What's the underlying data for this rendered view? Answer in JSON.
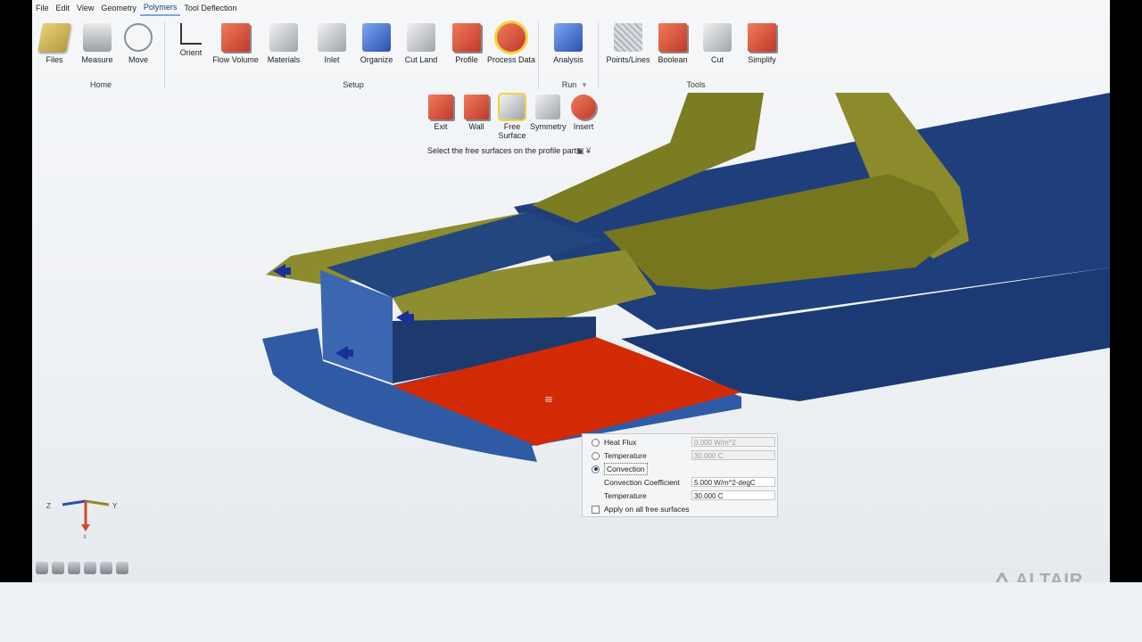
{
  "menubar": {
    "items": [
      "File",
      "Edit",
      "View",
      "Geometry",
      "Polymers",
      "Tool Deflection"
    ],
    "active": "Polymers"
  },
  "ribbon": {
    "home": {
      "label": "Home",
      "tools": [
        "Files",
        "Measure",
        "Move"
      ]
    },
    "setup": {
      "label": "Setup",
      "tools": [
        "Orient",
        "Flow Volume",
        "Materials",
        "Inlet",
        "Organize",
        "Cut Land",
        "Profile",
        "Process Data"
      ]
    },
    "run": {
      "label": "Run",
      "tools": [
        "Analysis"
      ]
    },
    "tools": {
      "label": "Tools",
      "tools": [
        "Points/Lines",
        "Boolean",
        "Cut",
        "Simplify"
      ]
    }
  },
  "profile_subtools": {
    "tools": [
      "Exit",
      "Wall",
      "Free Surface",
      "Symmetry",
      "Insert"
    ],
    "hint": "Select the free surfaces on the profile parts"
  },
  "bc_panel": {
    "heat_flux": {
      "label": "Heat Flux",
      "value": "0.000 W/m^2"
    },
    "temperature": {
      "label": "Temperature",
      "value": "30.000 C"
    },
    "convection": {
      "label": "Convection",
      "selected": true
    },
    "convection_coefficient": {
      "label": "Convection Coefficient",
      "value": "5.000 W/m^2-degC"
    },
    "convection_temperature": {
      "label": "Temperature",
      "value": "30.000 C"
    },
    "apply_all": {
      "label": "Apply on all free surfaces",
      "checked": false
    }
  },
  "triad": {
    "z": "Z",
    "y": "Y",
    "x": "X"
  },
  "brand": {
    "name": "ALTAIR"
  },
  "colors": {
    "accent": "#1a3d7a",
    "selected_surface": "#d32a06",
    "profile_blue": "#1e3f7a",
    "die_olive": "#8a8a2a"
  }
}
